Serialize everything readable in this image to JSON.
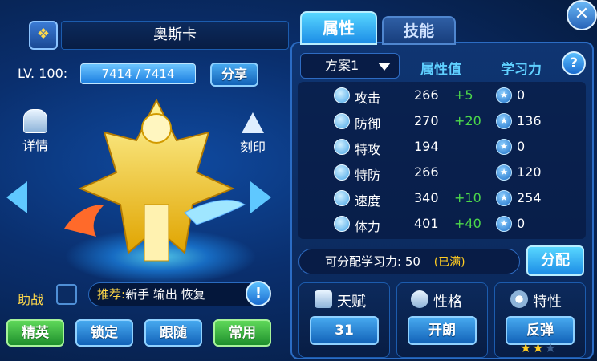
{
  "header": {
    "name": "奥斯卡",
    "level_label": "LV. 100:",
    "exp": "7414 / 7414",
    "share_label": "分享",
    "close_icon": "close-icon"
  },
  "left": {
    "detail_label": "详情",
    "imprint_label": "刻印",
    "assist_label": "助战",
    "recommend_label": "推荐:",
    "recommend_values": "新手  输出  恢复",
    "buttons": {
      "elite": "精英",
      "lock": "锁定",
      "follow": "跟随",
      "common": "常用"
    }
  },
  "tabs": {
    "attributes": "属性",
    "skills": "技能"
  },
  "table": {
    "plan": "方案1",
    "col_value": "属性值",
    "col_learning": "学习力",
    "help": "?",
    "rows": [
      {
        "label": "攻击",
        "value": "266",
        "bonus": "+5",
        "learning": "0"
      },
      {
        "label": "防御",
        "value": "270",
        "bonus": "+20",
        "learning": "136"
      },
      {
        "label": "特攻",
        "value": "194",
        "bonus": "",
        "learning": "0"
      },
      {
        "label": "特防",
        "value": "266",
        "bonus": "",
        "learning": "120"
      },
      {
        "label": "速度",
        "value": "340",
        "bonus": "+10",
        "learning": "254"
      },
      {
        "label": "体力",
        "value": "401",
        "bonus": "+40",
        "learning": "0"
      }
    ]
  },
  "allocate": {
    "label": "可分配学习力: 50",
    "full": "(已满)",
    "button": "分配"
  },
  "bottom": {
    "talent": {
      "label": "天赋",
      "value": "31"
    },
    "nature": {
      "label": "性格",
      "value": "开朗"
    },
    "trait": {
      "label": "特性",
      "value": "反弹",
      "stars": 2
    }
  },
  "colors": {
    "accent_green": "#4cd84a",
    "gold": "#ffcc22",
    "panel_border": "#1c5cae"
  }
}
